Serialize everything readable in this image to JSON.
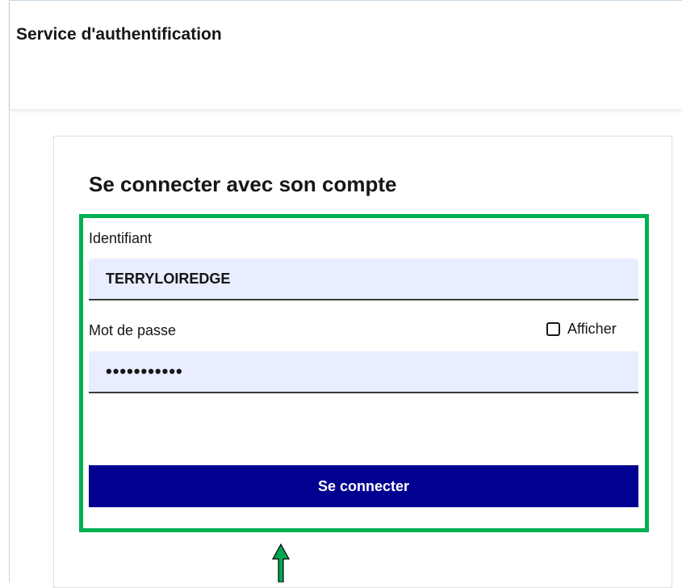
{
  "header": {
    "title": "Service d'authentification"
  },
  "form": {
    "title": "Se connecter avec son compte",
    "username_label": "Identifiant",
    "username_value": "TERRYLOIREDGE",
    "password_label": "Mot de passe",
    "password_value": "•••••••••••",
    "show_password_label": "Afficher",
    "show_password_checked": false,
    "submit_label": "Se connecter"
  },
  "colors": {
    "primary_button": "#000091",
    "input_background": "#e8edff",
    "highlight_box": "#00b050",
    "annotation_arrow": "#00a651"
  },
  "icons": {
    "annotation": "up-arrow-icon"
  }
}
